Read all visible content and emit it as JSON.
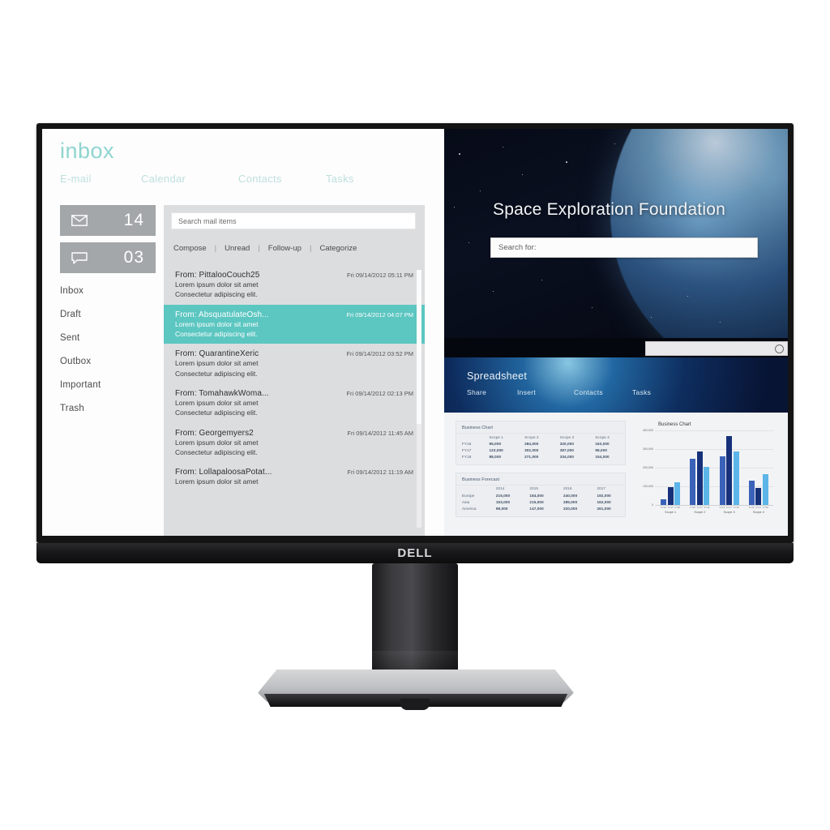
{
  "monitor": {
    "brand": "DELL"
  },
  "mail": {
    "brand": "inbox",
    "tabs": [
      {
        "label": "E-mail"
      },
      {
        "label": "Calendar"
      },
      {
        "label": "Contacts"
      },
      {
        "label": "Tasks"
      }
    ],
    "counters": [
      {
        "icon": "envelope-icon",
        "value": "14"
      },
      {
        "icon": "chat-bubble-icon",
        "value": "03"
      }
    ],
    "folders": [
      {
        "label": "Inbox"
      },
      {
        "label": "Draft"
      },
      {
        "label": "Sent"
      },
      {
        "label": "Outbox"
      },
      {
        "label": "Important"
      },
      {
        "label": "Trash"
      }
    ],
    "search": {
      "placeholder": "Search mail items",
      "value": ""
    },
    "toolbar": [
      {
        "label": "Compose"
      },
      {
        "label": "Unread"
      },
      {
        "label": "Follow-up"
      },
      {
        "label": "Categorize"
      }
    ],
    "separator": "|",
    "messages": [
      {
        "from": "From: PittalooCouch25",
        "date": "Fri 09/14/2012 05:11 PM",
        "line1": "Lorem ipsum dolor sit amet",
        "line2": "Consectetur adipiscing elit.",
        "selected": false
      },
      {
        "from": "From: AbsquatulateOsh...",
        "date": "Fri 09/14/2012 04:07 PM",
        "line1": "Lorem ipsum dolor sit amet",
        "line2": "Consectetur adipiscing elit.",
        "selected": true
      },
      {
        "from": "From: QuarantineXeric",
        "date": "Fri 09/14/2012 03:52 PM",
        "line1": "Lorem ipsum dolor sit amet",
        "line2": "Consectetur adipiscing elit.",
        "selected": false
      },
      {
        "from": "From: TomahawkWoma...",
        "date": "Fri 09/14/2012 02:13 PM",
        "line1": "Lorem ipsum dolor sit amet",
        "line2": "Consectetur adipiscing elit.",
        "selected": false
      },
      {
        "from": "From: Georgemyers2",
        "date": "Fri 09/14/2012 11:45 AM",
        "line1": "Lorem ipsum dolor sit amet",
        "line2": "Consectetur adipiscing elit.",
        "selected": false
      },
      {
        "from": "From: LollapaloosaPotat...",
        "date": "Fri 09/14/2012 11:19 AM",
        "line1": "Lorem ipsum dolor sit amet",
        "line2": "",
        "selected": false
      }
    ],
    "colors": {
      "accent": "#8fd5cf",
      "selected_row": "#5cc6c1",
      "counter_bg": "#a3a7a9"
    }
  },
  "browser": {
    "hero_title": "Space Exploration Foundation",
    "hero_search": {
      "placeholder": "Search for:",
      "value": ""
    },
    "spreadsheet": {
      "title": "Spreadsheet",
      "tabs": [
        {
          "label": "Share"
        },
        {
          "label": "Insert"
        },
        {
          "label": "Contacts"
        },
        {
          "label": "Tasks"
        }
      ],
      "table_business_chart": {
        "title": "Business Chart",
        "columns": [
          "",
          "Scope 1",
          "Scope 2",
          "Scope 3",
          "Scope 4"
        ],
        "rows": [
          [
            "FY16",
            "95,000",
            "284,000",
            "320,000",
            "163,000"
          ],
          [
            "FY17",
            "123,000",
            "302,000",
            "387,000",
            "98,000"
          ],
          [
            "FY18",
            "88,000",
            "271,000",
            "334,000",
            "154,000"
          ]
        ]
      },
      "table_business_forecast": {
        "title": "Business Forecast",
        "columns": [
          "",
          "2014",
          "2015",
          "2016",
          "2017"
        ],
        "rows": [
          [
            "Europe",
            "215,000",
            "184,000",
            "240,000",
            "192,000"
          ],
          [
            "Asia",
            "153,000",
            "215,000",
            "285,000",
            "162,000"
          ],
          [
            "America",
            "98,000",
            "147,000",
            "320,000",
            "261,000"
          ]
        ]
      }
    }
  },
  "chart_data": {
    "type": "bar",
    "title": "Business Chart",
    "xlabel": "",
    "ylabel": "",
    "ylim": [
      0,
      400000
    ],
    "grid": true,
    "legend": "none",
    "categories": [
      "Scope 1",
      "Scope 2",
      "Scope 3",
      "Scope 4"
    ],
    "tick_labels": [
      "FY16",
      "FY17",
      "FY18"
    ],
    "yticks": [
      "0",
      "100,000",
      "200,000",
      "300,000",
      "400,000"
    ],
    "series": [
      {
        "name": "FY16",
        "color": "#3a62b8",
        "values": [
          30000,
          250000,
          260000,
          130000
        ]
      },
      {
        "name": "FY17",
        "color": "#16317a",
        "values": [
          95000,
          285000,
          370000,
          90000
        ]
      },
      {
        "name": "FY18",
        "color": "#5bb5e8",
        "values": [
          120000,
          205000,
          285000,
          165000
        ]
      }
    ]
  }
}
